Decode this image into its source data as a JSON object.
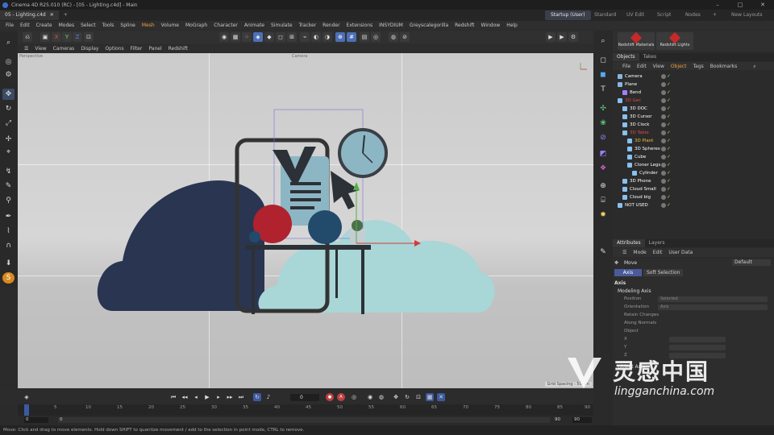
{
  "titlebar": {
    "title": "Cinema 4D R25.010 (RC) - [05 - Lighting.c4d] - Main"
  },
  "tabs": {
    "doc": "05 - Lighting.c4d",
    "add": "+"
  },
  "layouts": {
    "items": [
      "Startup (User)",
      "Standard",
      "UV Edit",
      "Script",
      "Nodes"
    ],
    "add": "+",
    "new": "New Layouts"
  },
  "menu": {
    "items": [
      "File",
      "Edit",
      "Create",
      "Modes",
      "Select",
      "Tools",
      "Spline",
      "Mesh",
      "Volume",
      "MoGraph",
      "Character",
      "Animate",
      "Simulate",
      "Tracker",
      "Render",
      "Extensions",
      "INSYDIUM",
      "Greyscalegorilla",
      "Redshift",
      "Window",
      "Help"
    ]
  },
  "axes": {
    "x": "X",
    "y": "Y",
    "z": "Z"
  },
  "vpmenu": {
    "items": [
      "View",
      "Cameras",
      "Display",
      "Options",
      "Filter",
      "Panel",
      "Redshift"
    ]
  },
  "viewport": {
    "label": "Perspective",
    "camera": "Camera",
    "grid": "Grid Spacing : 50 cm"
  },
  "redshift": {
    "materials": "Redshift Materials",
    "lights": "Redshift Lights"
  },
  "objects_tabs": [
    "Objects",
    "Takes"
  ],
  "objects_menu": [
    "File",
    "Edit",
    "View",
    "Object",
    "Tags",
    "Bookmarks"
  ],
  "objects": [
    {
      "name": "Camera",
      "color": "#ffffff"
    },
    {
      "name": "Plane",
      "color": "#ffffff"
    },
    {
      "name": "Bend",
      "color": "#ffffff"
    },
    {
      "name": "3D Gec",
      "color": "#e04848"
    },
    {
      "name": "3D DOC",
      "color": "#ffffff"
    },
    {
      "name": "3D Cursor",
      "color": "#ffffff"
    },
    {
      "name": "3D Clock",
      "color": "#ffffff"
    },
    {
      "name": "3D Table",
      "color": "#e04848"
    },
    {
      "name": "3D Plant",
      "color": "#f0c040"
    },
    {
      "name": "3D Spheres",
      "color": "#ffffff"
    },
    {
      "name": "Cube",
      "color": "#ffffff"
    },
    {
      "name": "Cloner Legs",
      "color": "#ffffff"
    },
    {
      "name": "Cylinder",
      "color": "#ffffff"
    },
    {
      "name": "3D Phone",
      "color": "#ffffff"
    },
    {
      "name": "Cloud Small",
      "color": "#ffffff"
    },
    {
      "name": "Cloud big",
      "color": "#ffffff"
    },
    {
      "name": "NOT USED",
      "color": "#ffffff"
    }
  ],
  "attr_tabs": [
    "Attributes",
    "Layers"
  ],
  "attr_menu": [
    "Mode",
    "Edit",
    "User Data"
  ],
  "attr": {
    "tool": "Move",
    "preset": "Default",
    "subtabs": [
      "Axis",
      "Soft Selection"
    ],
    "section": "Axis",
    "group": "Modeling Axis",
    "rows": [
      "Position",
      "Orientation",
      "Retain Changes",
      "Along Normals",
      "Object",
      "X",
      "Y",
      "Z"
    ],
    "position_val": "Selected",
    "orientation_val": "Axis",
    "object_axis": "Object Axis"
  },
  "frame": {
    "current": "0"
  },
  "ruler": {
    "ticks": [
      "0",
      "5",
      "10",
      "15",
      "20",
      "25",
      "30",
      "35",
      "40",
      "45",
      "50",
      "55",
      "60",
      "65",
      "70",
      "75",
      "80",
      "85",
      "90"
    ]
  },
  "range": {
    "start": "0",
    "start2": "0",
    "end": "90",
    "end2": "90"
  },
  "status": {
    "text": "Move: Click and drag to move elements. Hold down SHIFT to quantize movement / add to the selection in point mode, CTRL to remove."
  },
  "watermark": {
    "cn": "灵感中国",
    "url": "lingganchina.com"
  }
}
